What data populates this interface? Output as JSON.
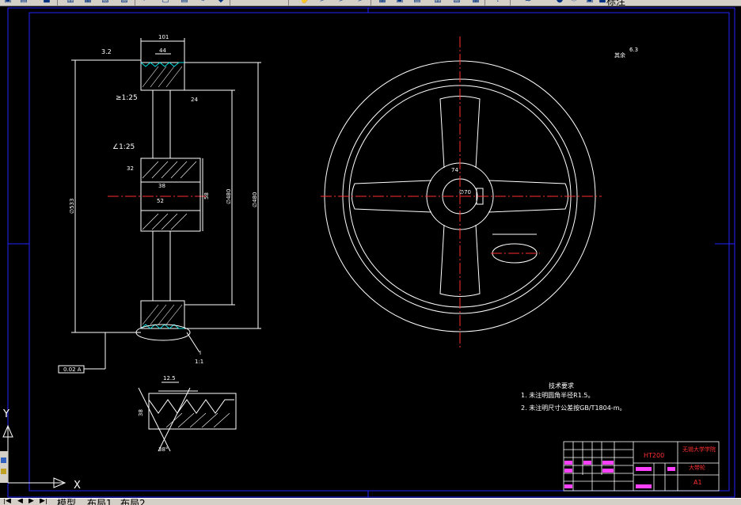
{
  "toolbar": {
    "layer_label": "标注"
  },
  "status": {
    "tabs": [
      "模型",
      "布局1",
      "布局2"
    ]
  },
  "drawing": {
    "roughness_main": "3.2",
    "roughness_corner": "6.3",
    "roughness_corner_prefix": "其余",
    "hub_bore": "∅70",
    "taper_1": "≥1:25",
    "taper_2": "∠1:25",
    "dim_rim_width": "101",
    "dim_top": "44",
    "dim_a": "32",
    "dim_b": "38",
    "dim_c": "52",
    "dim_d": "58",
    "dim_e": "74",
    "dim_f": "24",
    "dim_dia_big": "∅533",
    "dim_dia_mid": "∅480",
    "dim_dia_small": "∅480",
    "section_label": "I",
    "section_scale": "1:1",
    "tol_box": "0.02 A",
    "detail_dim_1": "12.5",
    "detail_dim_2": "38",
    "detail_angle": "38°",
    "tech_title": "技术要求",
    "tech_1": "1. 未注明圆角半径R1.5。",
    "tech_2": "2. 未注明尺寸公差按GB/T1804-m。",
    "material": "HT200",
    "drawing_name": "大带轮",
    "company": "无锡大学学院",
    "sheet": "A1",
    "ucs_y": "Y",
    "ucs_x": "X"
  },
  "colors": {
    "frame": "#2222ff",
    "line": "#ffffff",
    "center": "#ff3030",
    "hatch": "#00e0e0",
    "dim": "#ffffff",
    "magenta": "#ff40ff",
    "red_text": "#ff3030",
    "yellow": "#ffff00"
  }
}
